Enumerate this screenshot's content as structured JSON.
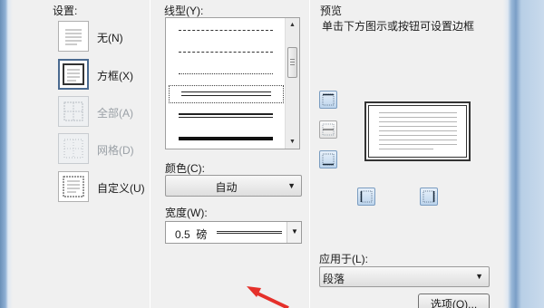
{
  "settings": {
    "title": "设置:",
    "items": [
      {
        "label": "无(N)",
        "state": "normal"
      },
      {
        "label": "方框(X)",
        "state": "selected"
      },
      {
        "label": "全部(A)",
        "state": "disabled"
      },
      {
        "label": "网格(D)",
        "state": "disabled"
      },
      {
        "label": "自定义(U)",
        "state": "normal"
      }
    ]
  },
  "style": {
    "label": "线型(Y):",
    "selected_index": 3,
    "line_styles": [
      "dash-dot",
      "dashed",
      "dash-dot-dot",
      "double-thin",
      "thick-thin",
      "thick"
    ]
  },
  "color": {
    "label": "颜色(C):",
    "value": "自动"
  },
  "width": {
    "label": "宽度(W):",
    "value": "0.5  磅"
  },
  "preview": {
    "title": "预览",
    "hint": "单击下方图示或按钮可设置边框"
  },
  "apply_to": {
    "label": "应用于(L):",
    "value": "段落"
  },
  "options_button": "选项(O)...",
  "colors": {
    "accent_border": "#4a6a90",
    "annotation_arrow": "#e5302a"
  }
}
